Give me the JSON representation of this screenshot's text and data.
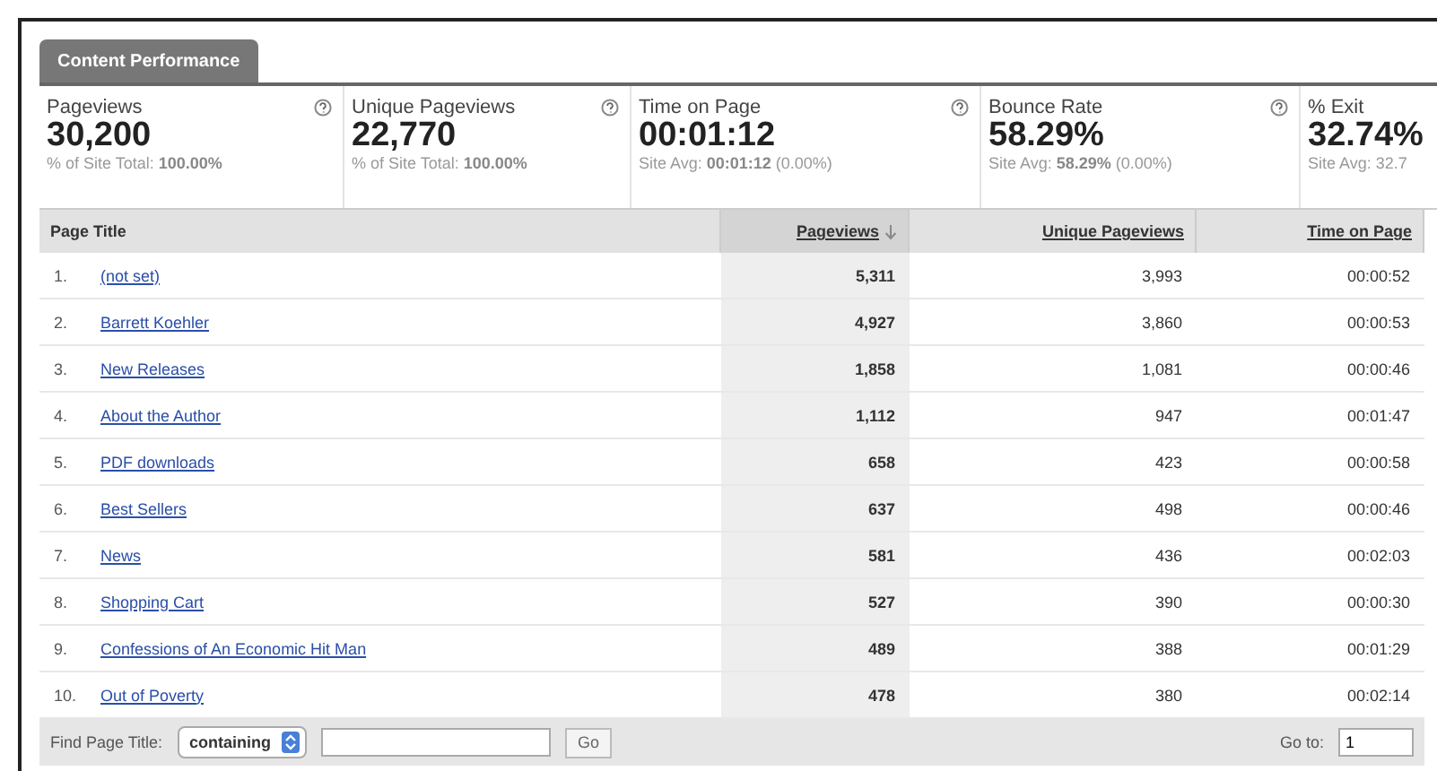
{
  "tabs": [
    {
      "label": "Content Performance",
      "selected": true
    }
  ],
  "metrics": [
    {
      "label": "Pageviews",
      "value": "30,200",
      "note": "% of Site Total: **100.00%**",
      "help": true
    },
    {
      "label": "Unique Pageviews",
      "value": "22,770",
      "note": "% of Site Total: **100.00%**",
      "help": true
    },
    {
      "label": "Time on Page",
      "value": "00:01:12",
      "note": "Site Avg: **00:01:12** (0.00%)",
      "help": true
    },
    {
      "label": "Bounce Rate",
      "value": "58.29%",
      "note": "Site Avg: **58.29%** (0.00%)",
      "help": true
    },
    {
      "label": "% Exit",
      "value": "32.74%",
      "note": "Site Avg: 32.7"
    }
  ],
  "table": {
    "columns": [
      {
        "label": "Page Title",
        "link": false,
        "sorted": false
      },
      {
        "label": "Pageviews",
        "link": true,
        "sorted": true
      },
      {
        "label": "Unique Pageviews",
        "link": true,
        "sorted": false
      },
      {
        "label": "Time on Page",
        "link": true,
        "sorted": false
      }
    ],
    "rows": [
      {
        "rank": "1.",
        "title": "(not set)",
        "pageviews": "5,311",
        "unique": "3,993",
        "time": "00:00:52"
      },
      {
        "rank": "2.",
        "title": "Barrett Koehler",
        "pageviews": "4,927",
        "unique": "3,860",
        "time": "00:00:53"
      },
      {
        "rank": "3.",
        "title": "New Releases",
        "pageviews": "1,858",
        "unique": "1,081",
        "time": "00:00:46"
      },
      {
        "rank": "4.",
        "title": "About the Author",
        "pageviews": "1,112",
        "unique": "947",
        "time": "00:01:47"
      },
      {
        "rank": "5.",
        "title": "PDF downloads",
        "pageviews": "658",
        "unique": "423",
        "time": "00:00:58"
      },
      {
        "rank": "6.",
        "title": "Best Sellers",
        "pageviews": "637",
        "unique": "498",
        "time": "00:00:46"
      },
      {
        "rank": "7.",
        "title": "News",
        "pageviews": "581",
        "unique": "436",
        "time": "00:02:03"
      },
      {
        "rank": "8.",
        "title": "Shopping Cart",
        "pageviews": "527",
        "unique": "390",
        "time": "00:00:30"
      },
      {
        "rank": "9.",
        "title": "Confessions of An Economic Hit Man",
        "pageviews": "489",
        "unique": "388",
        "time": "00:01:29"
      },
      {
        "rank": "10.",
        "title": "Out of Poverty",
        "pageviews": "478",
        "unique": "380",
        "time": "00:02:14"
      }
    ]
  },
  "footer": {
    "find_label": "Find Page Title:",
    "match_select": "containing",
    "go_button": "Go",
    "goto_label": "Go to:",
    "goto_value": "1"
  }
}
